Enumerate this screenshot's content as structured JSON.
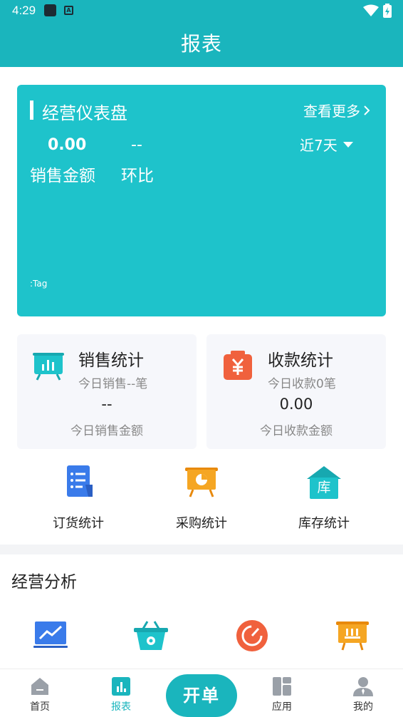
{
  "status_bar": {
    "time": "4:29",
    "a_glyph": "A"
  },
  "header": {
    "title": "报表"
  },
  "dashboard": {
    "title": "经营仪表盘",
    "more_label": "查看更多",
    "metrics": [
      {
        "value": "0.00",
        "label": "销售金额"
      },
      {
        "value": "--",
        "label": "环比"
      }
    ],
    "range": "近7天",
    "chart_tag": ":Tag"
  },
  "stats": [
    {
      "title": "销售统计",
      "subtitle": "今日销售--笔",
      "value": "--",
      "footer": "今日销售金额",
      "icon": "sales-board-icon"
    },
    {
      "title": "收款统计",
      "subtitle": "今日收款0笔",
      "value": "0.00",
      "footer": "今日收款金额",
      "icon": "yuan-receipt-icon"
    }
  ],
  "quick_stats": [
    {
      "label": "订货统计",
      "icon": "order-doc-icon"
    },
    {
      "label": "采购统计",
      "icon": "purchase-board-icon"
    },
    {
      "label": "库存统计",
      "icon": "warehouse-icon",
      "glyph": "库"
    }
  ],
  "analysis": {
    "title": "经营分析",
    "icons": [
      "trend-chart-icon",
      "basket-icon",
      "gauge-icon",
      "bar-board-icon"
    ]
  },
  "nav": [
    {
      "label": "首页",
      "icon": "home-icon"
    },
    {
      "label": "报表",
      "icon": "report-icon",
      "active": true
    },
    {
      "label": "应用",
      "icon": "apps-icon"
    },
    {
      "label": "我的",
      "icon": "profile-icon"
    }
  ],
  "fab_label": "开单",
  "colors": {
    "primary": "#1ab5bd",
    "card": "#1ec3cb",
    "orange": "#f39c12",
    "red": "#f0613d",
    "blue": "#3a7bea"
  }
}
